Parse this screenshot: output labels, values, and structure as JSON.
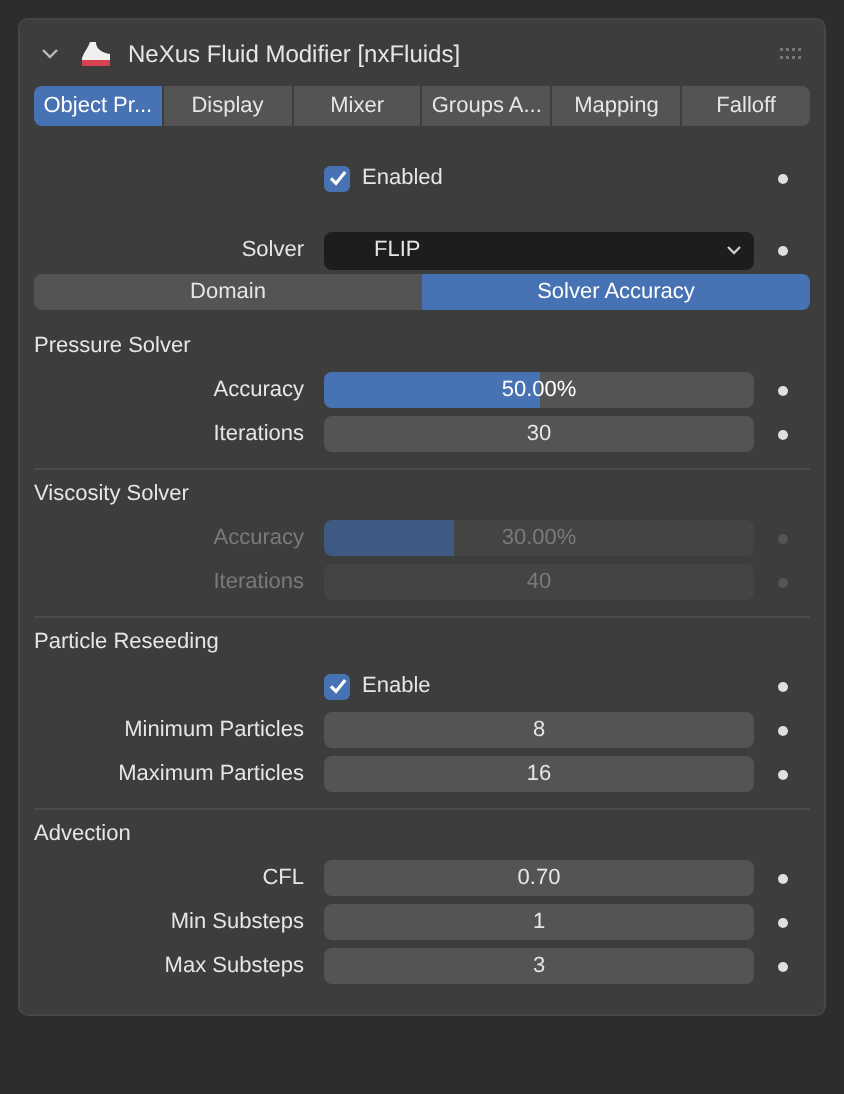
{
  "panel": {
    "title": "NeXus Fluid Modifier [nxFluids]",
    "expanded": true
  },
  "tabs": [
    {
      "label": "Object Pr...",
      "selected": true
    },
    {
      "label": "Display",
      "selected": false
    },
    {
      "label": "Mixer",
      "selected": false
    },
    {
      "label": "Groups A...",
      "selected": false
    },
    {
      "label": "Mapping",
      "selected": false
    },
    {
      "label": "Falloff",
      "selected": false
    }
  ],
  "enabled": {
    "label": "Enabled",
    "checked": true
  },
  "solver": {
    "label": "Solver",
    "value": "FLIP"
  },
  "subtabs": [
    {
      "label": "Domain",
      "selected": false
    },
    {
      "label": "Solver Accuracy",
      "selected": true
    }
  ],
  "sections": [
    {
      "title": "Pressure Solver",
      "items": [
        {
          "kind": "slider",
          "label": "Accuracy",
          "value": "50.00%",
          "level": 0.5,
          "disabled": false
        },
        {
          "kind": "number",
          "label": "Iterations",
          "value": "30",
          "disabled": false
        }
      ]
    },
    {
      "title": "Viscosity Solver",
      "items": [
        {
          "kind": "slider",
          "label": "Accuracy",
          "value": "30.00%",
          "level": 0.3,
          "disabled": true
        },
        {
          "kind": "number",
          "label": "Iterations",
          "value": "40",
          "disabled": true
        }
      ]
    },
    {
      "title": "Particle Reseeding",
      "items": [
        {
          "kind": "checkbox",
          "label": "Enable",
          "checked": true,
          "disabled": false
        },
        {
          "kind": "number",
          "label": "Minimum Particles",
          "value": "8",
          "disabled": false
        },
        {
          "kind": "number",
          "label": "Maximum Particles",
          "value": "16",
          "disabled": false
        }
      ]
    },
    {
      "title": "Advection",
      "items": [
        {
          "kind": "number",
          "label": "CFL",
          "value": "0.70",
          "disabled": false
        },
        {
          "kind": "number",
          "label": "Min Substeps",
          "value": "1",
          "disabled": false
        },
        {
          "kind": "number",
          "label": "Max Substeps",
          "value": "3",
          "disabled": false
        }
      ]
    }
  ]
}
